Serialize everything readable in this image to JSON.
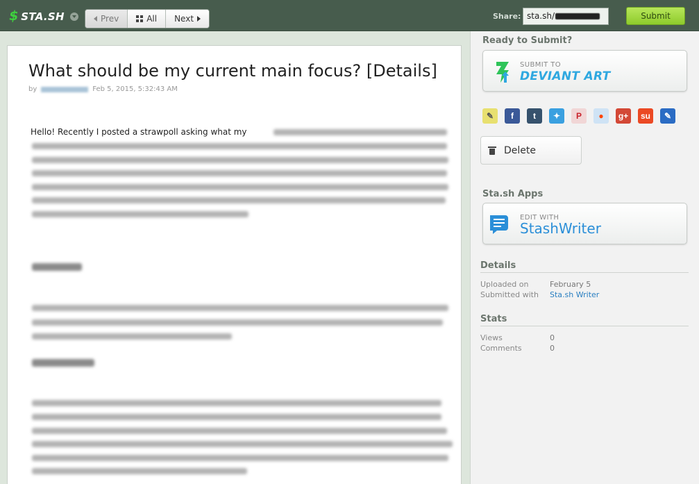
{
  "topbar": {
    "logo_text": "STA.SH",
    "nav": {
      "prev": "Prev",
      "all": "All",
      "next": "Next"
    },
    "share_label": "Share:",
    "share_value": "sta.sh/",
    "submit": "Submit"
  },
  "deviation": {
    "title": "What should be my current main focus? [Details]",
    "by_prefix": "by",
    "date": "Feb 5, 2015, 5:32:43 AM",
    "lead": "Hello! Recently I posted a strawpoll asking what my"
  },
  "sidebar": {
    "ready_label": "Ready to Submit?",
    "submit_to": {
      "small": "SUBMIT TO",
      "big": "DEVIANT ART"
    },
    "share_icons": [
      {
        "name": "note-icon",
        "glyph": "✎",
        "bg": "#e8e070",
        "fg": "#555"
      },
      {
        "name": "facebook-icon",
        "glyph": "f",
        "bg": "#3b5998",
        "fg": "#fff"
      },
      {
        "name": "tumblr-icon",
        "glyph": "t",
        "bg": "#36526d",
        "fg": "#fff"
      },
      {
        "name": "twitter-icon",
        "glyph": "✦",
        "bg": "#3aa0e0",
        "fg": "#fff"
      },
      {
        "name": "pinterest-icon",
        "glyph": "P",
        "bg": "#f1d6d6",
        "fg": "#c8232c"
      },
      {
        "name": "reddit-icon",
        "glyph": "●",
        "bg": "#cfe3f5",
        "fg": "#ff4500"
      },
      {
        "name": "google-plus-icon",
        "glyph": "g+",
        "bg": "#d34836",
        "fg": "#fff"
      },
      {
        "name": "stumbleupon-icon",
        "glyph": "su",
        "bg": "#eb4924",
        "fg": "#fff"
      },
      {
        "name": "edit-icon",
        "glyph": "✎",
        "bg": "#2b6cc4",
        "fg": "#fff"
      }
    ],
    "delete": "Delete",
    "apps_label": "Sta.sh Apps",
    "edit_with": {
      "small": "EDIT WITH",
      "big": "StashWriter"
    },
    "details": {
      "header": "Details",
      "rows": [
        {
          "key": "Uploaded on",
          "value": "February 5"
        },
        {
          "key": "Submitted with",
          "value": "Sta.sh Writer"
        }
      ]
    },
    "stats": {
      "header": "Stats",
      "rows": [
        {
          "key": "Views",
          "value": "0"
        },
        {
          "key": "Comments",
          "value": "0"
        }
      ]
    }
  }
}
